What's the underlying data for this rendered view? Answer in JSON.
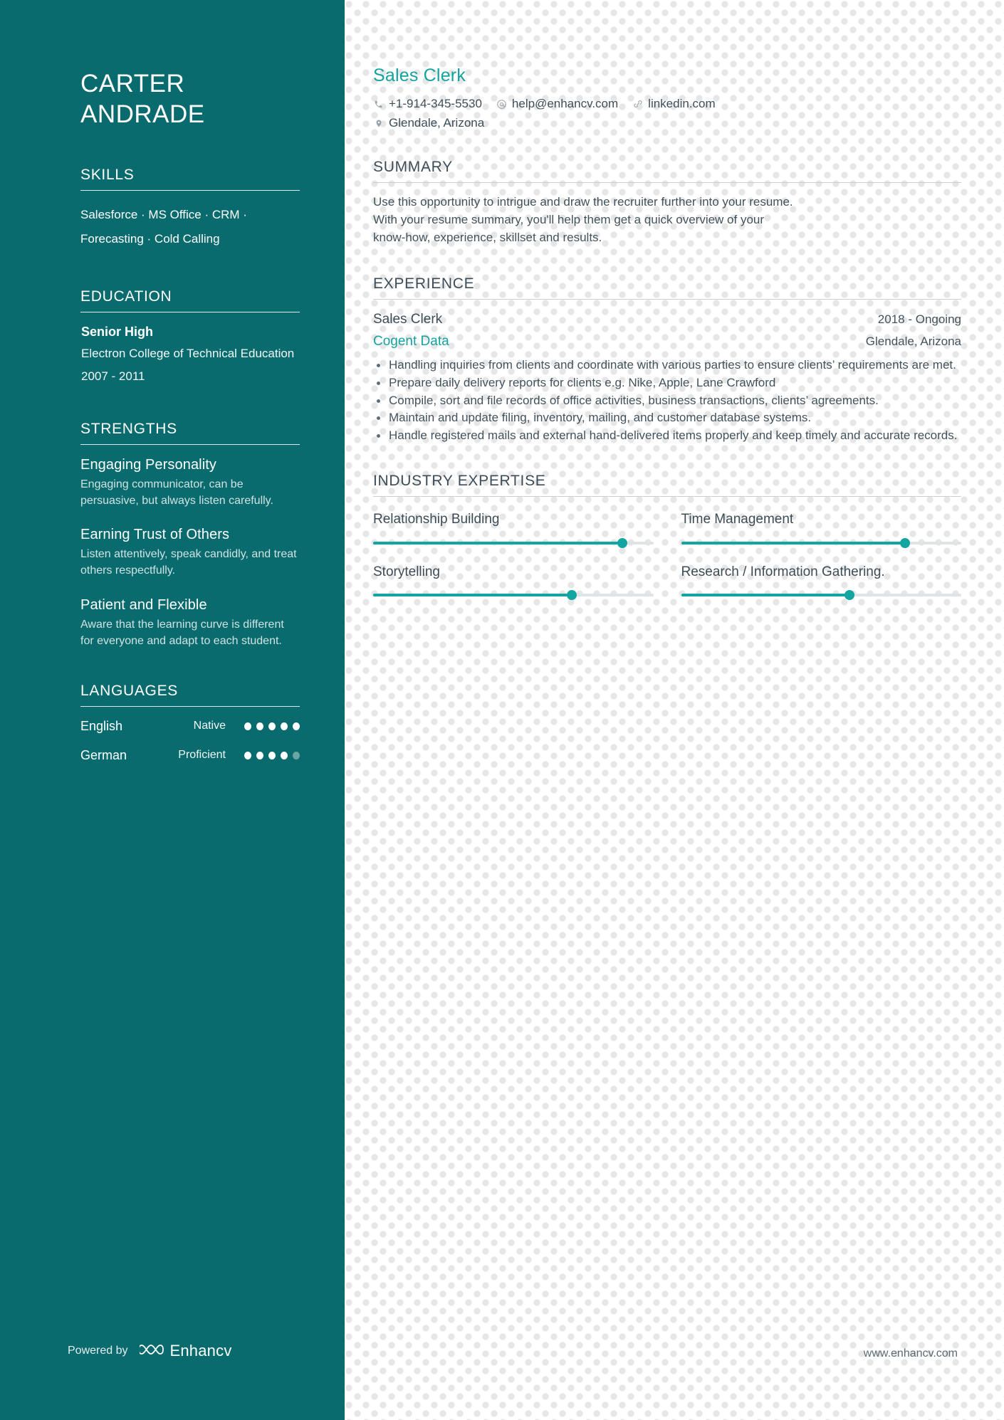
{
  "sidebar": {
    "name_lines": [
      "CARTER",
      "ANDRADE"
    ],
    "skills": {
      "heading": "SKILLS",
      "line1": "Salesforce · MS Office · CRM ·",
      "line2": "Forecasting · Cold Calling"
    },
    "education": {
      "heading": "EDUCATION",
      "degree": "Senior High",
      "school": "Electron College of Technical Education",
      "dates": "2007 - 2011"
    },
    "strengths": {
      "heading": "STRENGTHS",
      "items": [
        {
          "title": "Engaging Personality",
          "desc": "Engaging communicator, can be persuasive, but always listen carefully."
        },
        {
          "title": "Earning Trust of Others",
          "desc": "Listen attentively, speak candidly, and treat others respectfully."
        },
        {
          "title": "Patient and Flexible",
          "desc": "Aware that the learning curve is different for everyone and adapt to each student."
        }
      ]
    },
    "languages": {
      "heading": "LANGUAGES",
      "items": [
        {
          "name": "English",
          "level": "Native",
          "filled": 5,
          "total": 5
        },
        {
          "name": "German",
          "level": "Proficient",
          "filled": 4,
          "total": 5
        }
      ]
    },
    "footer": {
      "powered_label": "Powered by",
      "brand": "Enhancv"
    }
  },
  "main": {
    "job_title": "Sales Clerk",
    "contacts": [
      {
        "icon": "phone-icon",
        "text": "+1-914-345-5530"
      },
      {
        "icon": "email-icon",
        "text": "help@enhancv.com"
      },
      {
        "icon": "link-icon",
        "text": "linkedin.com"
      },
      {
        "icon": "location-icon",
        "text": "Glendale, Arizona"
      }
    ],
    "summary": {
      "heading": "SUMMARY",
      "text": "Use this opportunity to intrigue and draw the recruiter further into your resume. With your resume summary, you'll help them get a quick overview of your know-how, experience, skillset and results."
    },
    "experience": {
      "heading": "EXPERIENCE",
      "items": [
        {
          "role": "Sales Clerk",
          "dates": "2018 - Ongoing",
          "company": "Cogent Data",
          "location": "Glendale, Arizona",
          "bullets": [
            "Handling inquiries from clients and coordinate with various parties to ensure clients’ requirements are met.",
            "Prepare daily delivery reports for clients e.g. Nike, Apple, Lane Crawford",
            "Compile, sort and file records of office activities, business transactions, clients’ agreements.",
            "Maintain and update filing, inventory, mailing, and customer database systems.",
            "Handle registered mails and external hand-delivered items properly and keep timely and accurate records."
          ]
        }
      ]
    },
    "expertise": {
      "heading": "INDUSTRY EXPERTISE",
      "items": [
        {
          "label": "Relationship Building",
          "value": 89
        },
        {
          "label": "Time Management",
          "value": 80
        },
        {
          "label": "Storytelling",
          "value": 71
        },
        {
          "label": "Research / Information Gathering.",
          "value": 60
        }
      ]
    },
    "site_url": "www.enhancv.com"
  },
  "colors": {
    "sidebar_bg": "#0a6b6e",
    "accent": "#13a3a0",
    "text": "#42525c",
    "dot_pattern": "#e6e6e6"
  }
}
